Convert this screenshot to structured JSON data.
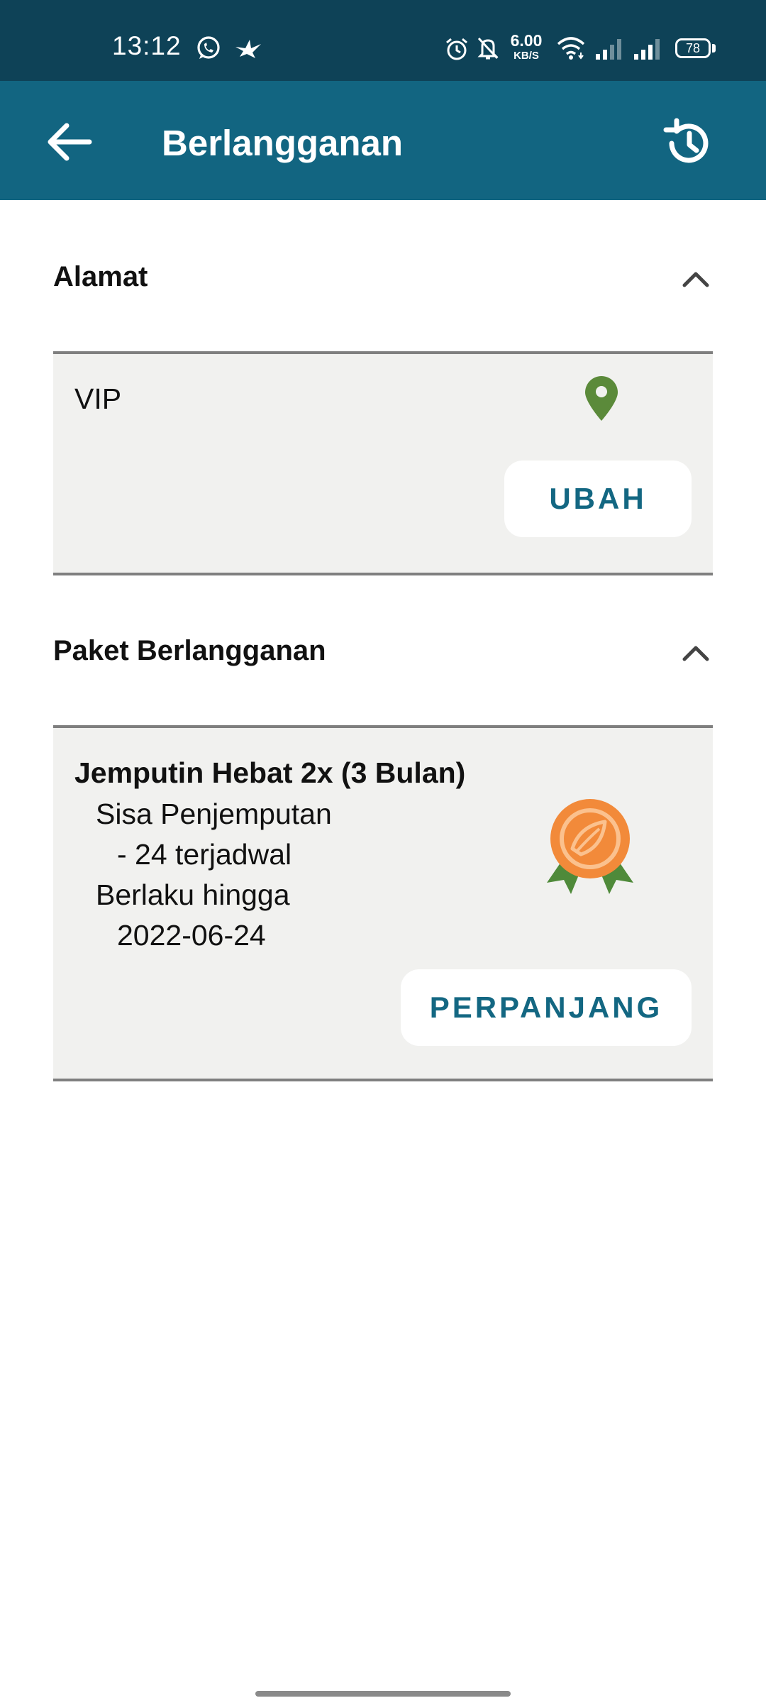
{
  "status_bar": {
    "time": "13:12",
    "net_speed_value": "6.00",
    "net_speed_unit": "KB/S",
    "battery": "78",
    "icons": [
      "whatsapp-icon",
      "bird-icon",
      "alarm-icon",
      "bell-off-icon",
      "wifi-icon",
      "signal-icon",
      "signal-icon",
      "battery-icon"
    ]
  },
  "app_bar": {
    "title": "Berlangganan",
    "back_icon": "arrow-left-icon",
    "history_icon": "history-icon",
    "background": "#126581"
  },
  "address_section": {
    "title": "Alamat",
    "name": "VIP",
    "pin_color": "#5b8a3a",
    "button_label": "UBAH"
  },
  "package_section": {
    "title": "Paket Berlangganan",
    "package_name": "Jemputin Hebat 2x (3 Bulan)",
    "remaining_label": "Sisa Penjemputan",
    "remaining_value": "- 24 terjadwal",
    "valid_label": "Berlaku hingga",
    "valid_value": "2022-06-24",
    "button_label": "PERPANJANG",
    "medal_color": "#f28a3a"
  }
}
